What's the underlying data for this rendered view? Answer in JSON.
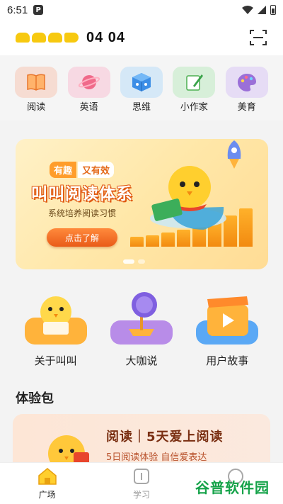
{
  "status_bar": {
    "time": "6:51",
    "notification_badge": "P"
  },
  "header": {
    "logo_text": "04 04",
    "scan_icon": "scan-icon"
  },
  "categories": [
    {
      "label": "阅读",
      "icon": "book-icon",
      "color": "#f6dcd2"
    },
    {
      "label": "英语",
      "icon": "planet-icon",
      "color": "#f7d9e3"
    },
    {
      "label": "思维",
      "icon": "dice-icon",
      "color": "#d5e8f7"
    },
    {
      "label": "小作家",
      "icon": "notebook-icon",
      "color": "#d7efd9"
    },
    {
      "label": "美育",
      "icon": "palette-icon",
      "color": "#e6dcf5"
    }
  ],
  "banner": {
    "tag_left": "有趣",
    "tag_right": "又有效",
    "headline": "叫叫阅读体系",
    "subtitle": "系统培养阅读习惯",
    "cta": "点击了解",
    "active_slide": 1,
    "slide_count": 2
  },
  "features": [
    {
      "label": "关于叫叫",
      "icon": "mascot-icon"
    },
    {
      "label": "大咖说",
      "icon": "microphone-icon"
    },
    {
      "label": "用户故事",
      "icon": "video-clapper-icon"
    }
  ],
  "section": {
    "title": "体验包",
    "card_title": "阅读｜5天爱上阅读",
    "card_subtitle": "5日阅读体验 自信爱表达"
  },
  "bottom_nav": [
    {
      "label": "广场",
      "icon": "home-icon",
      "active": true
    },
    {
      "label": "学习",
      "icon": "study-icon",
      "active": false
    },
    {
      "label": "",
      "icon": "profile-icon",
      "active": false
    }
  ],
  "watermark": "谷普软件园",
  "colors": {
    "brand_yellow": "#f7c910",
    "accent_orange": "#e95b18"
  }
}
